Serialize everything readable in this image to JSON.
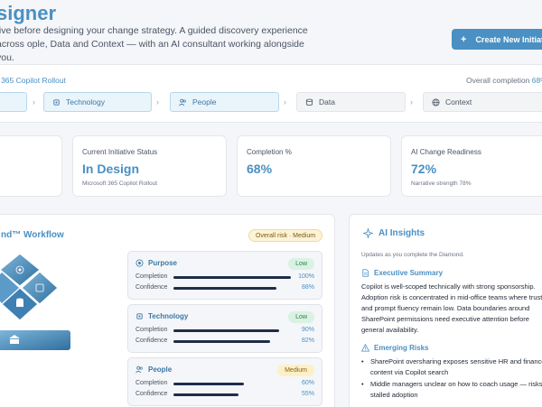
{
  "header": {
    "title": "signer",
    "subtitle": "tive before designing your change strategy. A guided discovery experience across ople, Data and Context — with an AI consultant working alongside you.",
    "new_button": "Create New Initiati"
  },
  "stepbar": {
    "initiative": "ft 365 Copilot Rollout",
    "overall_label": "Overall completion",
    "overall_value": "68%",
    "steps": [
      {
        "label": "Technology",
        "icon": "chip-icon"
      },
      {
        "label": "People",
        "icon": "people-icon"
      },
      {
        "label": "Data",
        "icon": "database-icon"
      },
      {
        "label": "Context",
        "icon": "globe-icon"
      }
    ]
  },
  "cards": {
    "status": {
      "label": "Current Initiative Status",
      "value": "In Design",
      "sub": "Microsoft 365 Copilot Rollout"
    },
    "completion": {
      "label": "Completion %",
      "value": "68%"
    },
    "readiness": {
      "label": "AI Change Readiness",
      "value": "72%",
      "sub": "Narrative strength 78%"
    }
  },
  "workflow": {
    "title": "nd™ Workflow",
    "risk": "Overall risk · Medium",
    "completion_label": "Completion",
    "confidence_label": "Confidence",
    "dimensions": [
      {
        "name": "Purpose",
        "icon": "target-icon",
        "level": "Low",
        "completion": "100%",
        "confidence": "88%",
        "completion_value": 100,
        "confidence_value": 88
      },
      {
        "name": "Technology",
        "icon": "chip-icon",
        "level": "Low",
        "completion": "90%",
        "confidence": "82%",
        "completion_value": 90,
        "confidence_value": 82
      },
      {
        "name": "People",
        "icon": "people-icon",
        "level": "Medium",
        "completion": "60%",
        "confidence": "55%",
        "completion_value": 60,
        "confidence_value": 55
      }
    ]
  },
  "ai": {
    "title": "AI Insights",
    "updated": "Updates as you complete the Diamond.",
    "summary_title": "Executive Summary",
    "summary": "Copilot is well-scoped technically with strong sponsorship. Adoption risk is concentrated in mid-office teams where trust and prompt fluency remain low. Data boundaries around SharePoint permissions need executive attention before general availability.",
    "risks_title": "Emerging Risks",
    "risks": [
      "SharePoint oversharing exposes sensitive HR and finance content via Copilot search",
      "Middle managers unclear on how to coach usage — risks stalled adoption"
    ]
  },
  "colors": {
    "accent": "#4a90c2",
    "bar": "#1f2d4a",
    "risk_bg": "#fdf3d6"
  }
}
